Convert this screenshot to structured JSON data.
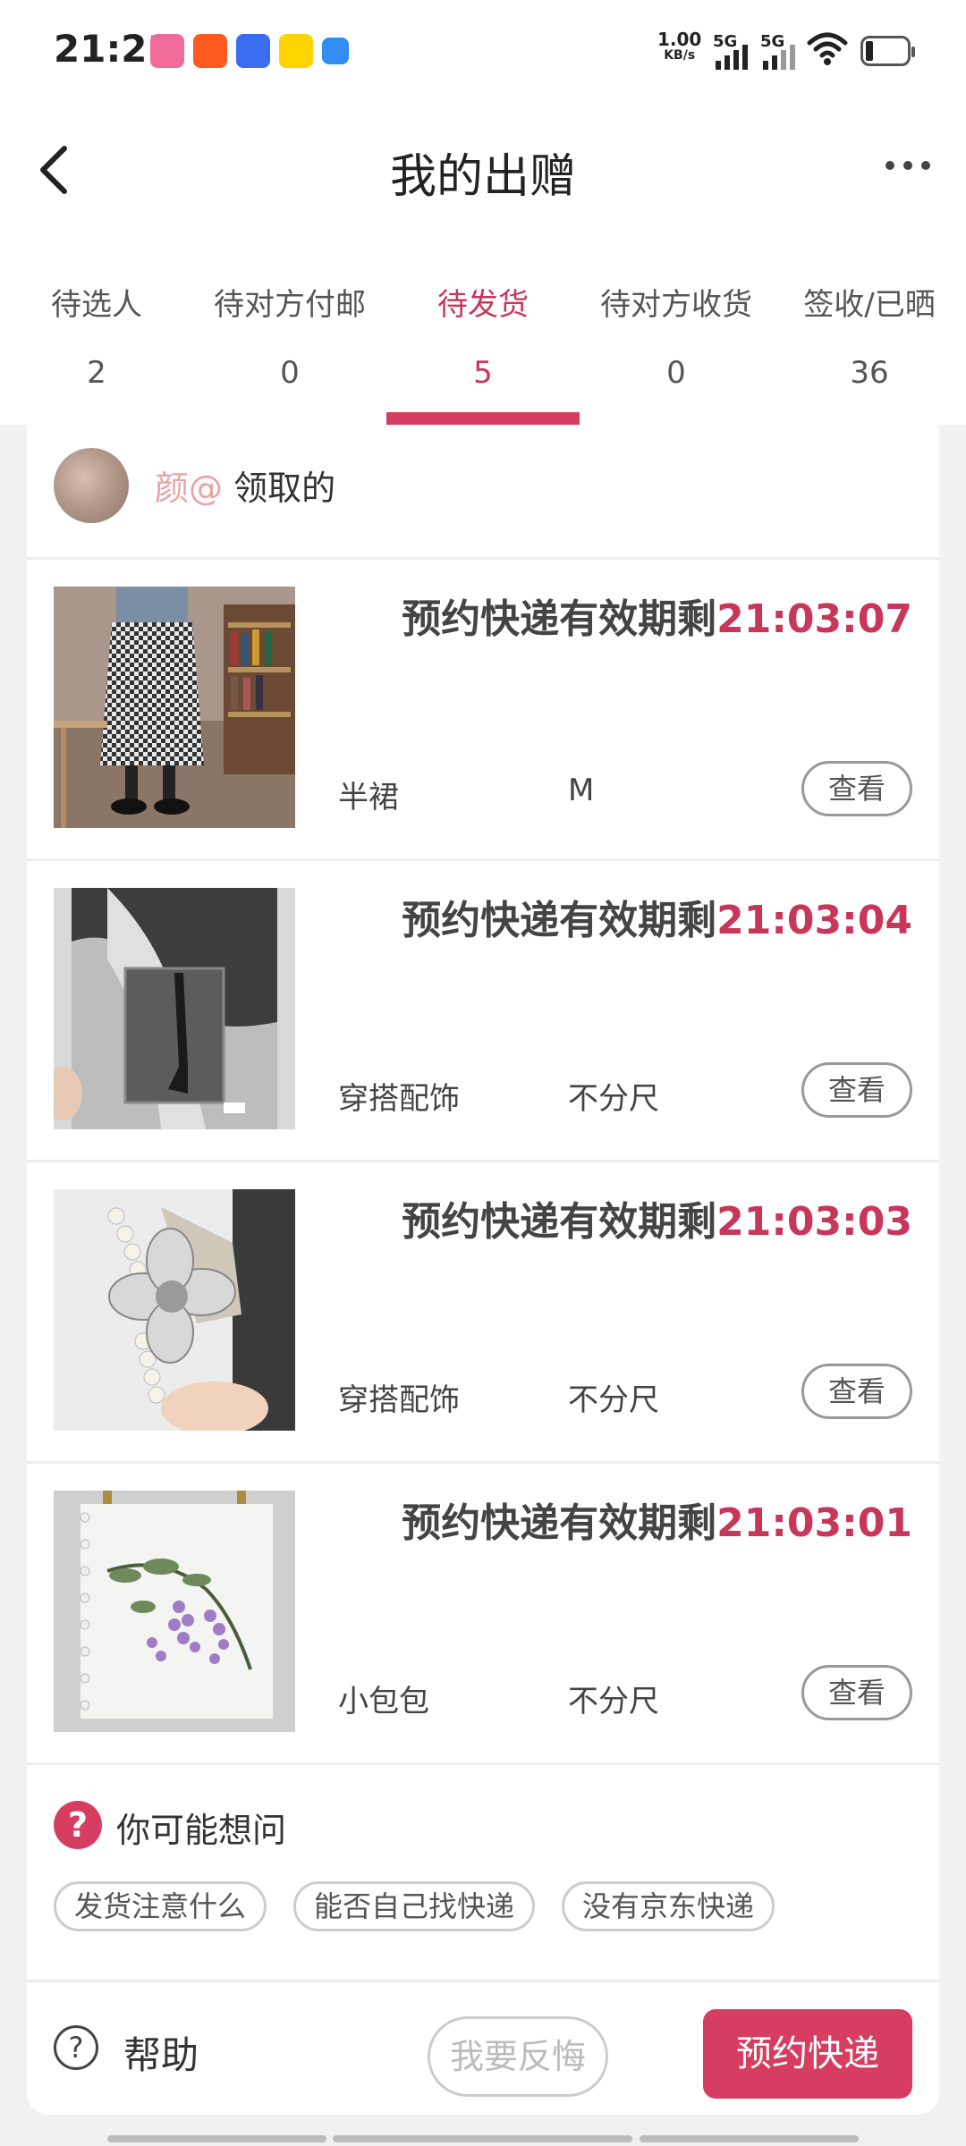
{
  "status_bar": {
    "time": "21:21",
    "net_speed_value": "1.00",
    "net_speed_unit": "KB/s",
    "sim1": "5G",
    "sim2": "5G",
    "app_icons": [
      "bilibili-icon",
      "taobao-icon",
      "baidu-icon",
      "app-icon-yellow",
      "app-icon-blue"
    ]
  },
  "header": {
    "title": "我的出赠"
  },
  "tabs": [
    {
      "label": "待选人",
      "count": "2"
    },
    {
      "label": "待对方付邮",
      "count": "0"
    },
    {
      "label": "待发货",
      "count": "5",
      "active": true
    },
    {
      "label": "待对方收货",
      "count": "0"
    },
    {
      "label": "签收/已晒",
      "count": "36"
    }
  ],
  "recipient": {
    "name": "颜@",
    "suffix": "领取的"
  },
  "items": [
    {
      "countdown_label": "预约快递有效期剩",
      "countdown": "21:03:07",
      "category": "半裙",
      "size": "M",
      "view_label": "查看",
      "image": "houndstooth-skirt-photo"
    },
    {
      "countdown_label": "预约快递有效期剩",
      "countdown": "21:03:04",
      "category": "穿搭配饰",
      "size": "不分尺",
      "view_label": "查看",
      "image": "stockings-package-photo"
    },
    {
      "countdown_label": "预约快递有效期剩",
      "countdown": "21:03:03",
      "category": "穿搭配饰",
      "size": "不分尺",
      "view_label": "查看",
      "image": "pearl-flower-hairclip-photo"
    },
    {
      "countdown_label": "预约快递有效期剩",
      "countdown": "21:03:01",
      "category": "小包包",
      "size": "不分尺",
      "view_label": "查看",
      "image": "embroidered-grape-bag-photo"
    }
  ],
  "faq": {
    "icon": "?",
    "title": "你可能想问",
    "chips": [
      "发货注意什么",
      "能否自己找快递",
      "没有京东快递"
    ]
  },
  "bottom_bar": {
    "help_icon": "?",
    "help_label": "帮助",
    "regret_label": "我要反悔",
    "book_label": "预约快递"
  },
  "colors": {
    "accent": "#d63d60",
    "accent_text": "#c8365a",
    "recipient_name": "#e6a4a6"
  }
}
